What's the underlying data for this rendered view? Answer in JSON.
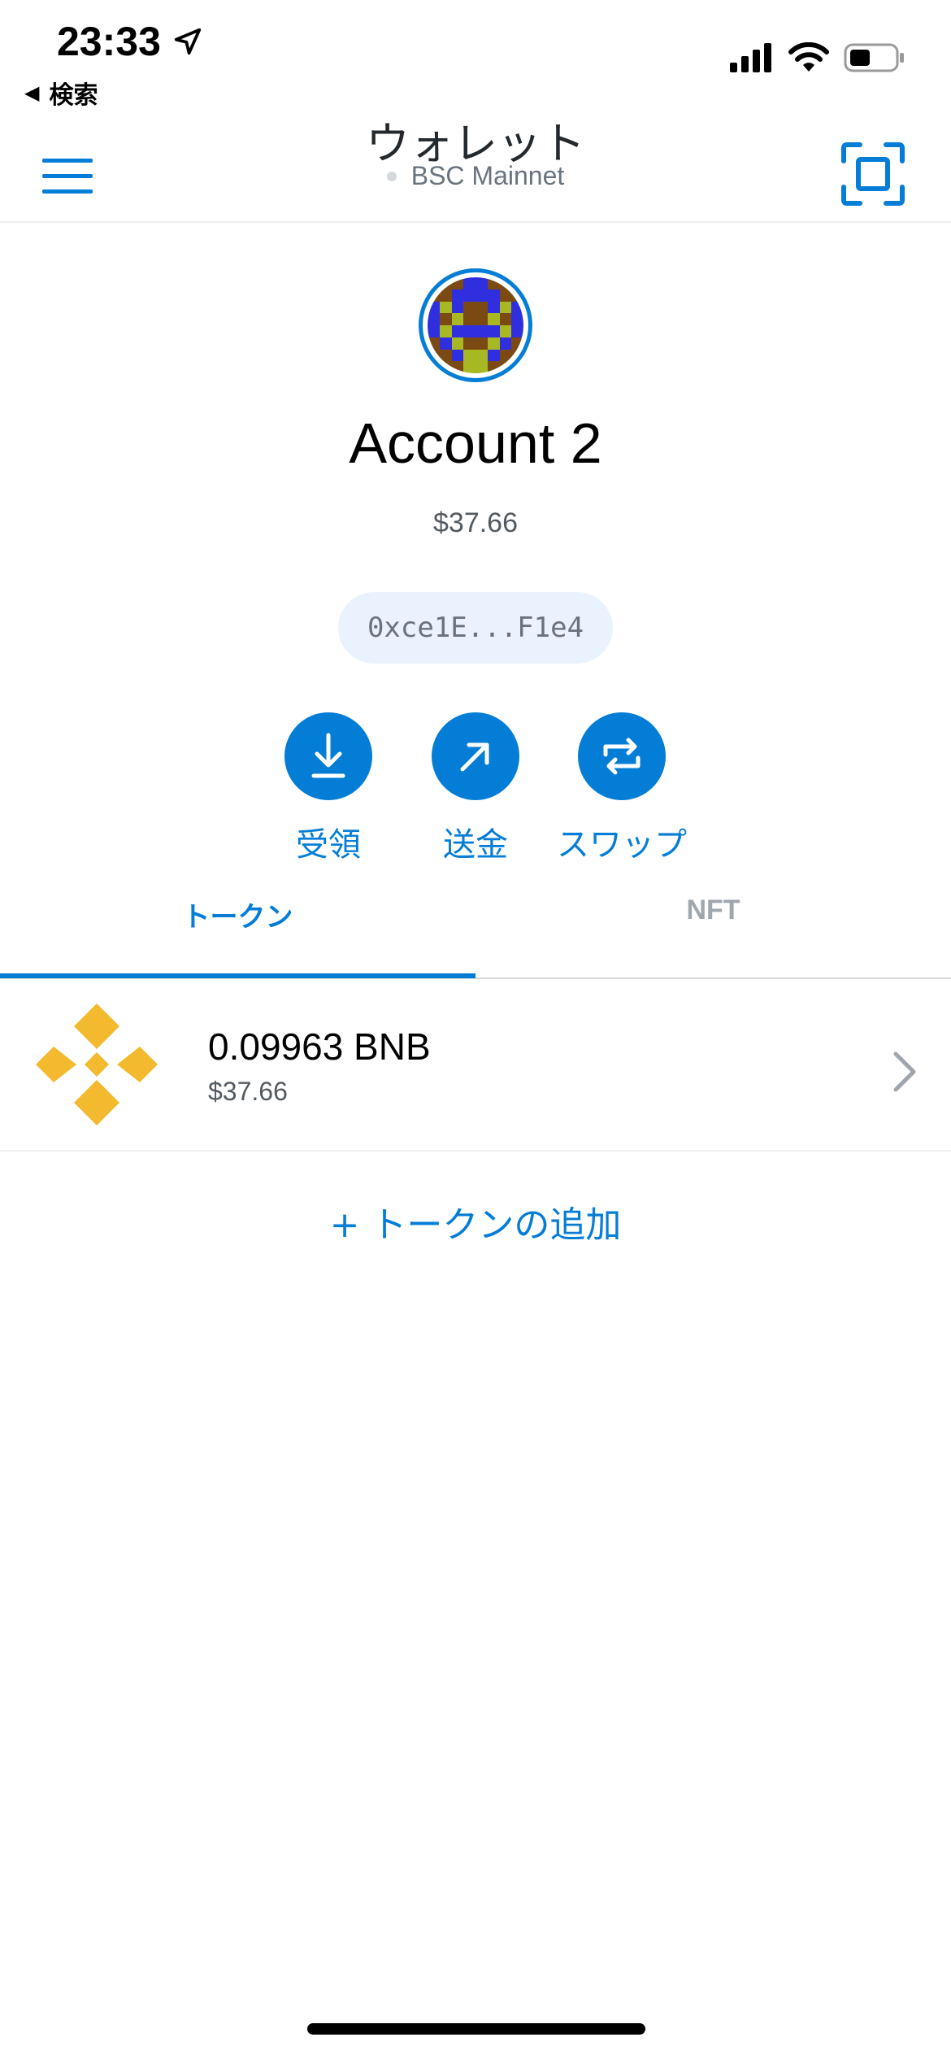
{
  "status_bar": {
    "time": "23:33",
    "back_app": "検索"
  },
  "nav": {
    "title": "ウォレット",
    "network": "BSC Mainnet"
  },
  "account": {
    "name": "Account 2",
    "balance": "$37.66",
    "address": "0xce1E...F1e4"
  },
  "actions": {
    "receive": "受領",
    "send": "送金",
    "swap": "スワップ"
  },
  "tabs": {
    "tokens": "トークン",
    "nft": "NFT",
    "active": "tokens"
  },
  "tokens": [
    {
      "symbol_icon": "bnb-logo-icon",
      "amount": "0.09963 BNB",
      "fiat": "$37.66"
    }
  ],
  "add_token_label": "+ トークンの追加",
  "colors": {
    "accent": "#037dd6",
    "bnb": "#f3ba2f",
    "address_bg": "#eaf3fd"
  }
}
